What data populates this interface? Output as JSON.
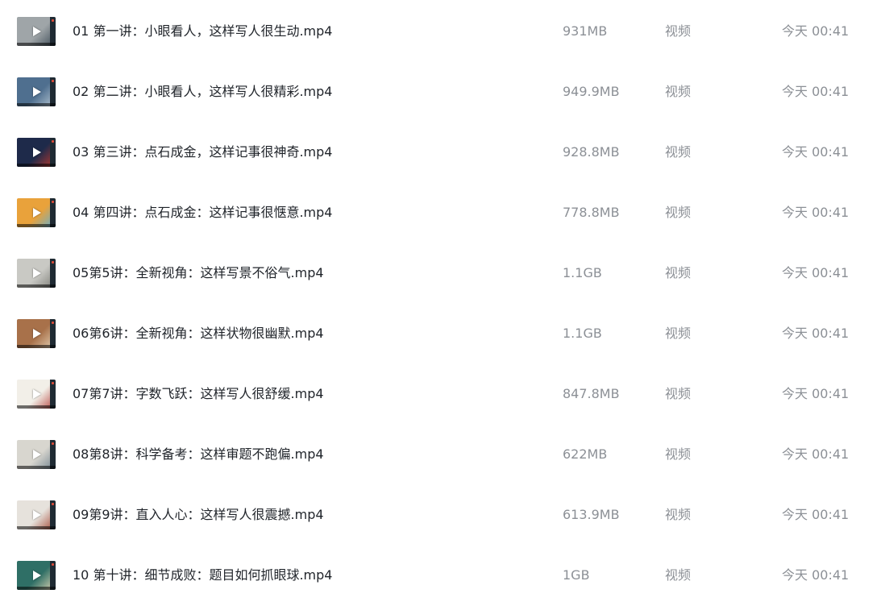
{
  "files": [
    {
      "name": "01 第一讲：小眼看人，这样写人很生动.mp4",
      "size": "931MB",
      "type": "视频",
      "modified": "今天 00:41",
      "thumb_bg": "#9fa5a8",
      "thumb_accent": "#3c4a55"
    },
    {
      "name": "02 第二讲：小眼看人，这样写人很精彩.mp4",
      "size": "949.9MB",
      "type": "视频",
      "modified": "今天 00:41",
      "thumb_bg": "#4f6f8f",
      "thumb_accent": "#b9c9d6"
    },
    {
      "name": "03 第三讲：点石成金，这样记事很神奇.mp4",
      "size": "928.8MB",
      "type": "视频",
      "modified": "今天 00:41",
      "thumb_bg": "#1e2a4a",
      "thumb_accent": "#c0392b"
    },
    {
      "name": "04 第四讲：点石成金：这样记事很惬意.mp4",
      "size": "778.8MB",
      "type": "视频",
      "modified": "今天 00:41",
      "thumb_bg": "#e9a23b",
      "thumb_accent": "#5ab0d8"
    },
    {
      "name": "05第5讲：全新视角：这样写景不俗气.mp4",
      "size": "1.1GB",
      "type": "视频",
      "modified": "今天 00:41",
      "thumb_bg": "#c9c9c4",
      "thumb_accent": "#7a7a74"
    },
    {
      "name": "06第6讲：全新视角：这样状物很幽默.mp4",
      "size": "1.1GB",
      "type": "视频",
      "modified": "今天 00:41",
      "thumb_bg": "#a8714a",
      "thumb_accent": "#e8d5b8"
    },
    {
      "name": "07第7讲：字数飞跃：这样写人很舒缓.mp4",
      "size": "847.8MB",
      "type": "视频",
      "modified": "今天 00:41",
      "thumb_bg": "#f2efe8",
      "thumb_accent": "#b4403a"
    },
    {
      "name": "08第8讲：科学备考：这样审题不跑偏.mp4",
      "size": "622MB",
      "type": "视频",
      "modified": "今天 00:41",
      "thumb_bg": "#d8d6cf",
      "thumb_accent": "#6d7f8a"
    },
    {
      "name": "09第9讲：直入人心：这样写人很震撼.mp4",
      "size": "613.9MB",
      "type": "视频",
      "modified": "今天 00:41",
      "thumb_bg": "#e6e2dc",
      "thumb_accent": "#a2432f"
    },
    {
      "name": "10 第十讲：细节成败：题目如何抓眼球.mp4",
      "size": "1GB",
      "type": "视频",
      "modified": "今天 00:41",
      "thumb_bg": "#2f6f66",
      "thumb_accent": "#e5d9b6"
    }
  ]
}
